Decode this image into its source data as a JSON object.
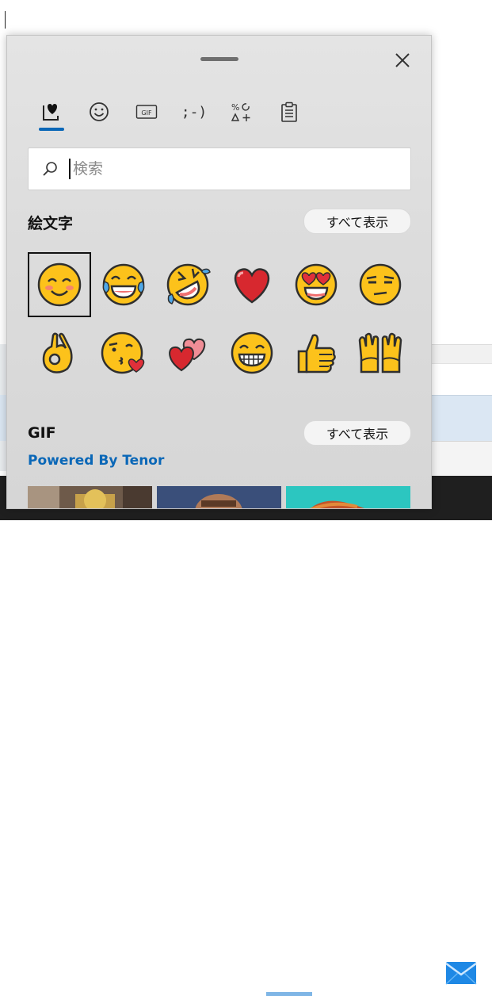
{
  "panel": {
    "close_icon": "close-icon",
    "drag_handle": "drag-handle"
  },
  "tabs": [
    {
      "id": "favorites",
      "icon": "heart-clipboard-icon",
      "active": true
    },
    {
      "id": "emoji",
      "icon": "smiley-icon",
      "active": false
    },
    {
      "id": "gif",
      "icon": "gif-icon",
      "label": "GIF",
      "active": false
    },
    {
      "id": "kaomoji",
      "icon": "kaomoji-icon",
      "label": ";-)",
      "active": false
    },
    {
      "id": "symbols",
      "icon": "symbols-icon",
      "label": "%↻△+",
      "active": false
    },
    {
      "id": "clipboard",
      "icon": "clipboard-icon",
      "active": false
    }
  ],
  "search": {
    "placeholder": "検索",
    "value": ""
  },
  "emoji_section": {
    "title": "絵文字",
    "show_all": "すべて表示",
    "items": [
      {
        "name": "smiling-face-with-smiling-eyes",
        "selected": true
      },
      {
        "name": "face-with-tears-of-joy",
        "selected": false
      },
      {
        "name": "rolling-on-the-floor-laughing",
        "selected": false
      },
      {
        "name": "red-heart",
        "selected": false
      },
      {
        "name": "smiling-face-with-heart-eyes",
        "selected": false
      },
      {
        "name": "unamused-face",
        "selected": false
      },
      {
        "name": "ok-hand",
        "selected": false
      },
      {
        "name": "face-blowing-a-kiss",
        "selected": false
      },
      {
        "name": "two-hearts",
        "selected": false
      },
      {
        "name": "beaming-face-with-smiling-eyes",
        "selected": false
      },
      {
        "name": "thumbs-up",
        "selected": false
      },
      {
        "name": "raising-hands",
        "selected": false
      }
    ]
  },
  "gif_section": {
    "title": "GIF",
    "show_all": "すべて表示",
    "powered_by": "Powered By Tenor"
  },
  "colors": {
    "accent": "#0a67b7",
    "emoji_yellow": "#fcc21b",
    "heart_red": "#d7282f"
  },
  "taskbar": {
    "mail_icon": "mail-icon"
  }
}
